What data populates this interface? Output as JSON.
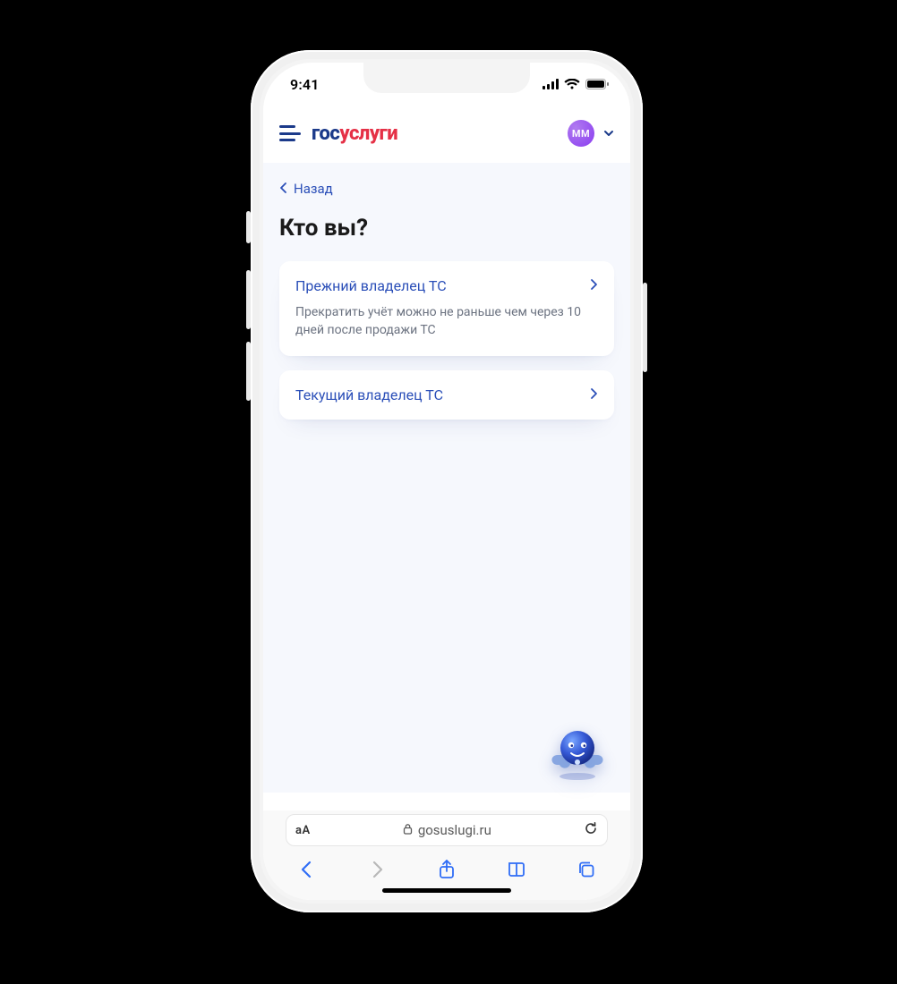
{
  "status": {
    "time": "9:41"
  },
  "header": {
    "logo_part1": "гос",
    "logo_part2": "услуги",
    "avatar_initials": "MM"
  },
  "back": {
    "label": "Назад"
  },
  "title": "Кто вы?",
  "options": [
    {
      "label": "Прежний владелец ТС",
      "sub": "Прекратить учёт можно не раньше чем через 10 дней после продажи ТС"
    },
    {
      "label": "Текущий владелец ТС",
      "sub": ""
    }
  ],
  "browser": {
    "reader": "aA",
    "domain": "gosuslugi.ru"
  }
}
